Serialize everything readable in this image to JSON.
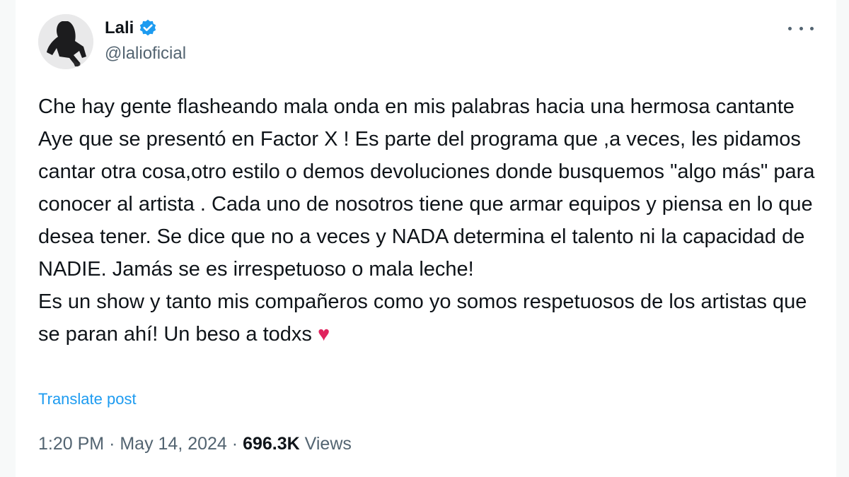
{
  "author": {
    "display_name": "Lali",
    "handle": "@lalioficial",
    "verified": true
  },
  "post": {
    "paragraph1": "Che hay gente flasheando mala onda en mis palabras hacia una hermosa cantante Aye que se presentó en Factor X ! Es parte del programa que ,a veces, les pidamos cantar otra cosa,otro estilo o demos devoluciones donde busquemos \"algo más\" para conocer al artista . Cada uno de nosotros tiene que armar equipos y piensa en lo que desea tener. Se dice que no a veces y NADA determina el talento ni la capacidad de NADIE. Jamás se es irrespetuoso o mala leche!",
    "paragraph2": "Es un show y tanto mis compañeros como yo somos respetuosos de los artistas que se paran ahí! Un beso a todxs",
    "emoji": "♥",
    "translate_label": "Translate post"
  },
  "meta": {
    "time": "1:20 PM",
    "separator": "·",
    "date": "May 14, 2024",
    "views_count": "696.3K",
    "views_label": "Views"
  },
  "icons": {
    "verified": "verified-badge-icon",
    "more": "more-options-icon"
  },
  "colors": {
    "accent": "#1d9bf0",
    "text": "#0f1419",
    "secondary": "#536471",
    "heart": "#e0245e"
  }
}
